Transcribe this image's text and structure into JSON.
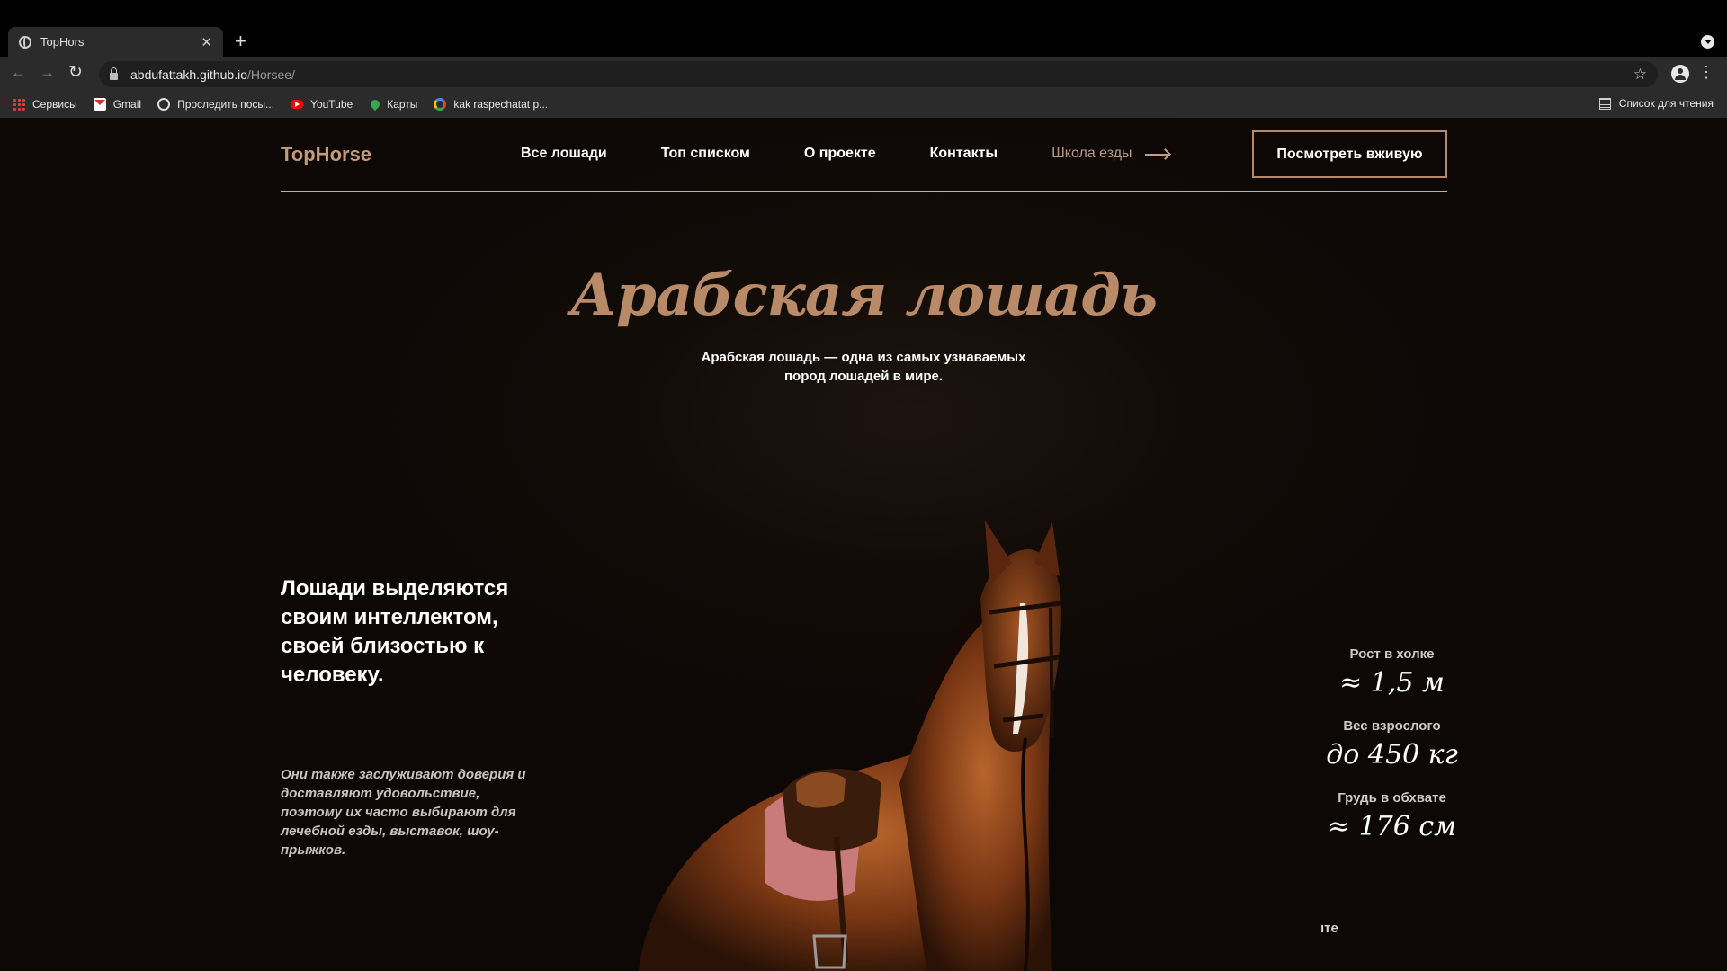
{
  "browser": {
    "tab_title": "TopHors",
    "url_host": "abdufattakh.github.io",
    "url_path": "/Horsee/",
    "bookmarks": [
      {
        "label": "Сервисы",
        "icon": "apps-icon"
      },
      {
        "label": "Gmail",
        "icon": "gmail-icon"
      },
      {
        "label": "Проследить посы...",
        "icon": "track-icon"
      },
      {
        "label": "YouTube",
        "icon": "youtube-icon"
      },
      {
        "label": "Карты",
        "icon": "maps-icon"
      },
      {
        "label": "kak raspechatat p...",
        "icon": "google-icon"
      }
    ],
    "reading_list": "Список для чтения"
  },
  "site": {
    "logo": "TopHorse",
    "nav": [
      "Все лошади",
      "Топ списком",
      "О проекте",
      "Контакты"
    ],
    "nav_school": "Школа езды",
    "cta": "Посмотреть вживую",
    "hero_title": "Арабская лошадь",
    "hero_subtitle": "Арабская лошадь — одна из самых узнаваемых пород лошадей в мире.",
    "lead": "Лошади выделяются своим интеллектом, своей близостью к человеку.",
    "note": "Они также заслуживают доверия и доставляют удовольствие, поэтому их часто выбирают для лечебной езды, выставок, шоу-прыжков.",
    "stats": [
      {
        "label": "Рост в холке",
        "value": "≈ 1,5 м"
      },
      {
        "label": "Вес взрослого",
        "value": "до 450 кг"
      },
      {
        "label": "Грудь в обхвате",
        "value": "≈ 176 см"
      }
    ],
    "cut_text": "ıте"
  },
  "colors": {
    "accent": "#c39c76",
    "title": "#b88a67",
    "background": "#0d0806"
  }
}
